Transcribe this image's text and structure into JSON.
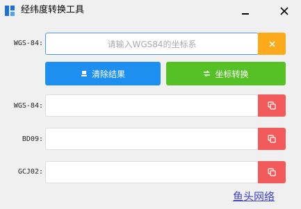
{
  "window": {
    "title": "经纬度转换工具"
  },
  "input": {
    "label": "WGS-84:",
    "placeholder": "请输入WGS84的坐标系"
  },
  "buttons": {
    "clear_label": "清除结果",
    "convert_label": "坐标转换"
  },
  "results": [
    {
      "label": "WGS-84:",
      "value": ""
    },
    {
      "label": "BD09:",
      "value": ""
    },
    {
      "label": "GCJ02:",
      "value": ""
    }
  ],
  "footer": {
    "link": "鱼头网络"
  },
  "colors": {
    "blue": "#1d8ff1",
    "green": "#55c126",
    "orange": "#fcaa1c",
    "red": "#f15a5a",
    "focus": "#4f94ef"
  },
  "icons": [
    "app-icon",
    "minimize-icon",
    "close-icon",
    "clear-x-icon",
    "eraser-icon",
    "convert-icon",
    "copy-icon"
  ]
}
